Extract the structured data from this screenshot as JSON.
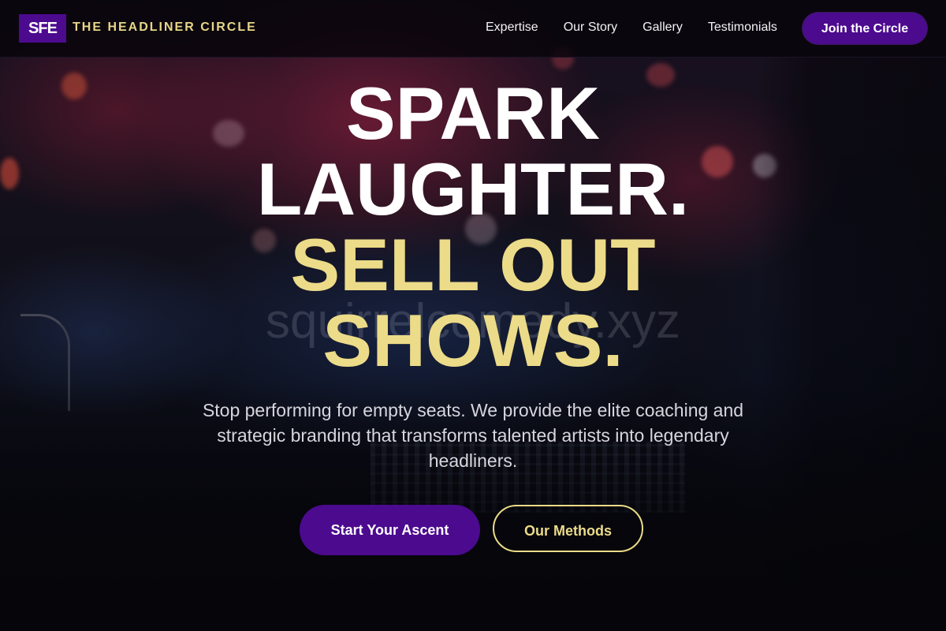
{
  "brand": {
    "logo_text": "SFE",
    "name": "THE HEADLINER CIRCLE"
  },
  "nav": {
    "items": [
      {
        "label": "Expertise"
      },
      {
        "label": "Our Story"
      },
      {
        "label": "Gallery"
      },
      {
        "label": "Testimonials"
      }
    ],
    "cta_label": "Join the Circle"
  },
  "hero": {
    "headline_lines": [
      "SPARK",
      "LAUGHTER.",
      "SELL OUT",
      "SHOWS."
    ],
    "watermark": "squirrelcomedy.xyz",
    "subheadline": "Stop performing for empty seats. We provide the elite coaching and strategic branding that transforms talented artists into legendary headliners.",
    "primary_cta": "Start Your Ascent",
    "secondary_cta": "Our Methods"
  },
  "colors": {
    "accent_purple": "#4c0a8f",
    "accent_gold": "#ecdb88",
    "text_white": "#ffffff"
  }
}
